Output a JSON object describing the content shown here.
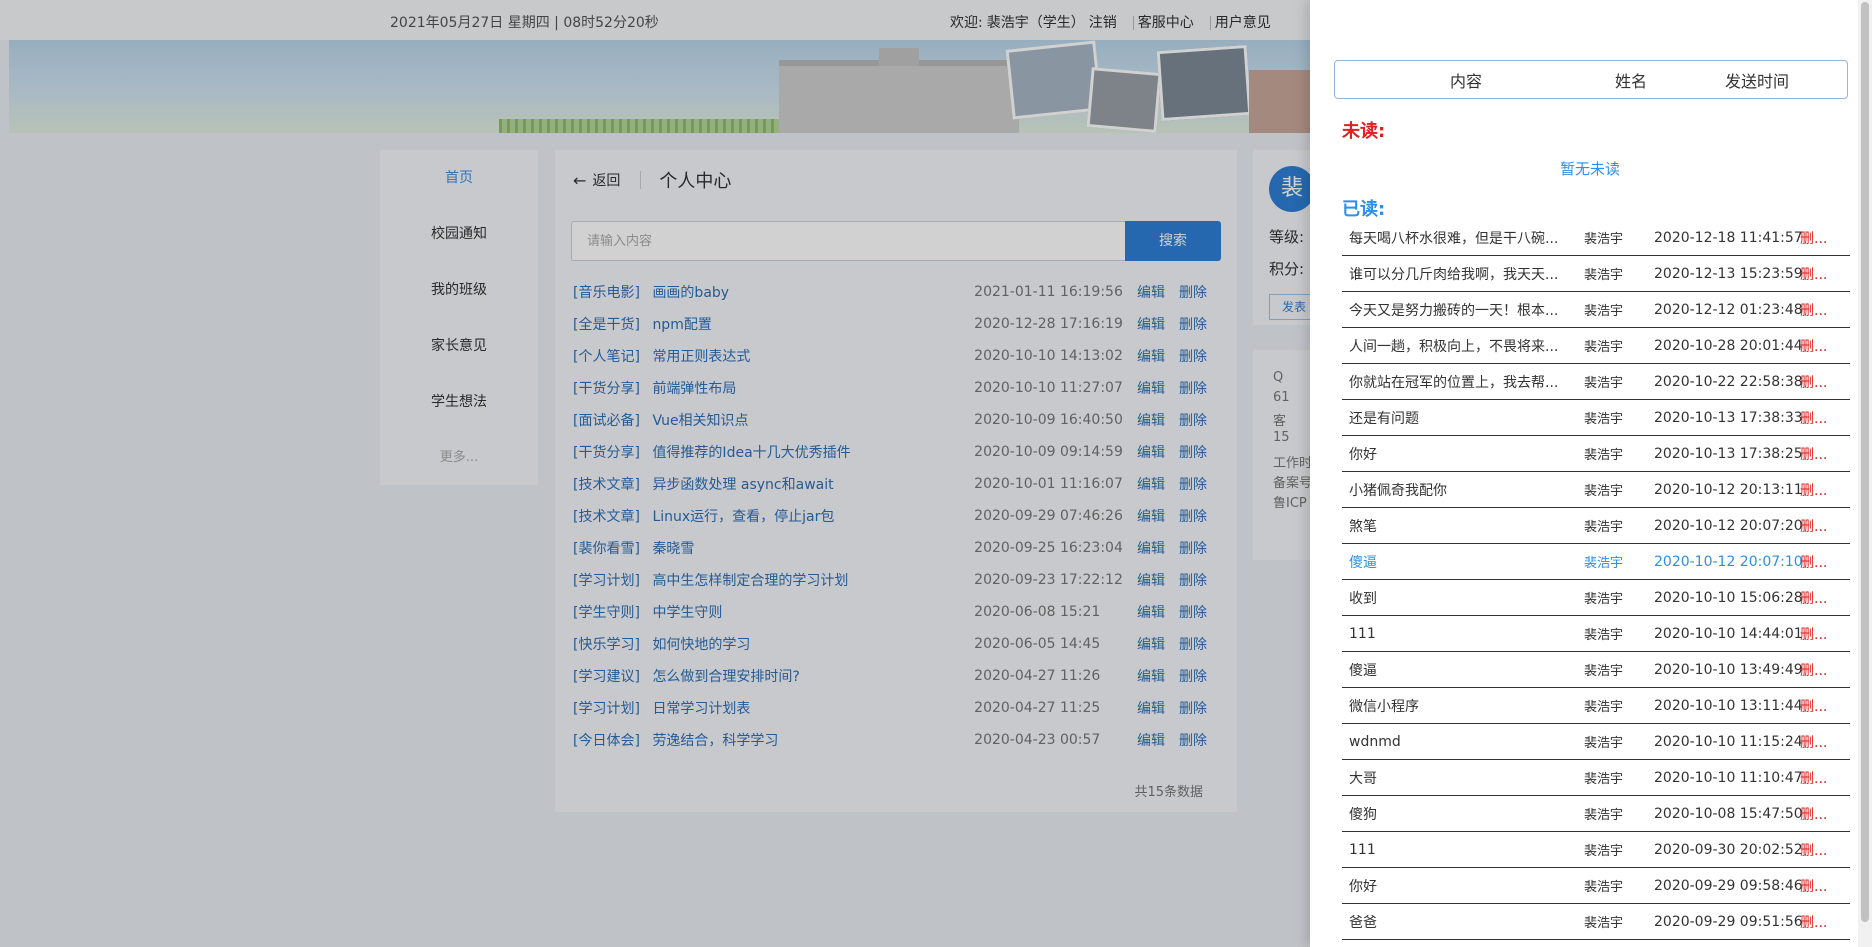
{
  "topbar": {
    "datetime": "2021年05月27日 星期四 | 08时52分20秒",
    "welcome_prefix": "欢迎:",
    "user": "裴浩宇（学生）",
    "logout": "注销",
    "service": "客服中心",
    "feedback": "用户意见"
  },
  "leftnav": {
    "items": [
      {
        "label": "首页"
      },
      {
        "label": "校园通知"
      },
      {
        "label": "我的班级"
      },
      {
        "label": "家长意见"
      },
      {
        "label": "学生想法"
      },
      {
        "label": "更多..."
      }
    ]
  },
  "main": {
    "back": "返回",
    "title": "个人中心",
    "search_placeholder": "请输入内容",
    "search_button": "搜索",
    "edit": "编辑",
    "delete": "删除",
    "rows": [
      {
        "cat": "[音乐电影]",
        "title": "画画的baby",
        "time": "2021-01-11 16:19:56"
      },
      {
        "cat": "[全是干货]",
        "title": "npm配置",
        "time": "2020-12-28 17:16:19"
      },
      {
        "cat": "[个人笔记]",
        "title": "常用正则表达式",
        "time": "2020-10-10 14:13:02"
      },
      {
        "cat": "[干货分享]",
        "title": "前端弹性布局",
        "time": "2020-10-10 11:27:07"
      },
      {
        "cat": "[面试必备]",
        "title": "Vue相关知识点",
        "time": "2020-10-09 16:40:50"
      },
      {
        "cat": "[干货分享]",
        "title": "值得推荐的Idea十几大优秀插件",
        "time": "2020-10-09 09:14:59"
      },
      {
        "cat": "[技术文章]",
        "title": "异步函数处理 async和await",
        "time": "2020-10-01 11:16:07"
      },
      {
        "cat": "[技术文章]",
        "title": "Linux运行，查看，停止jar包",
        "time": "2020-09-29 07:46:26"
      },
      {
        "cat": "[裴你看雪]",
        "title": "秦晓雪",
        "time": "2020-09-25 16:23:04"
      },
      {
        "cat": "[学习计划]",
        "title": "高中生怎样制定合理的学习计划",
        "time": "2020-09-23 17:22:12"
      },
      {
        "cat": "[学生守则]",
        "title": "中学生守则",
        "time": "2020-06-08 15:21"
      },
      {
        "cat": "[快乐学习]",
        "title": "如何快地的学习",
        "time": "2020-06-05 14:45"
      },
      {
        "cat": "[学习建议]",
        "title": "怎么做到合理安排时间?",
        "time": "2020-04-27 11:26"
      },
      {
        "cat": "[学习计划]",
        "title": "日常学习计划表",
        "time": "2020-04-27 11:25"
      },
      {
        "cat": "[今日体会]",
        "title": "劳逸结合，科学学习",
        "time": "2020-04-23 00:57"
      }
    ],
    "total": "共15条数据"
  },
  "rightcard": {
    "avatar": "裴",
    "level": "等级:",
    "points": "积分:",
    "btn": "发表",
    "info": [
      "Q",
      "61",
      "客",
      "15",
      "工作时",
      "备案号",
      "鲁ICP"
    ]
  },
  "drawer": {
    "col_content": "内容",
    "col_name": "姓名",
    "col_time": "发送时间",
    "unread_label": "未读:",
    "no_unread": "暂无未读",
    "read_label": "已读:",
    "messages": [
      {
        "text": "每天喝八杯水很难，但是干八碗...",
        "name": "裴浩宇",
        "time": "2020-12-18 11:41:57",
        "del": "删..."
      },
      {
        "text": "谁可以分几斤肉给我啊，我天天...",
        "name": "裴浩宇",
        "time": "2020-12-13 15:23:59",
        "del": "删..."
      },
      {
        "text": "今天又是努力搬砖的一天！根本...",
        "name": "裴浩宇",
        "time": "2020-12-12 01:23:48",
        "del": "删..."
      },
      {
        "text": "人间一趟，积极向上，不畏将来...",
        "name": "裴浩宇",
        "time": "2020-10-28 20:01:44",
        "del": "删..."
      },
      {
        "text": "你就站在冠军的位置上，我去帮...",
        "name": "裴浩宇",
        "time": "2020-10-22 22:58:38",
        "del": "删..."
      },
      {
        "text": "还是有问题",
        "name": "裴浩宇",
        "time": "2020-10-13 17:38:33",
        "del": "删..."
      },
      {
        "text": "你好",
        "name": "裴浩宇",
        "time": "2020-10-13 17:38:25",
        "del": "删..."
      },
      {
        "text": "小猪佩奇我配你",
        "name": "裴浩宇",
        "time": "2020-10-12 20:13:11",
        "del": "删..."
      },
      {
        "text": "煞笔",
        "name": "裴浩宇",
        "time": "2020-10-12 20:07:20",
        "del": "删..."
      },
      {
        "text": "傻逼",
        "name": "裴浩宇",
        "time": "2020-10-12 20:07:10",
        "del": "删..."
      },
      {
        "text": "收到",
        "name": "裴浩宇",
        "time": "2020-10-10 15:06:28",
        "del": "删..."
      },
      {
        "text": "111",
        "name": "裴浩宇",
        "time": "2020-10-10 14:44:01",
        "del": "删..."
      },
      {
        "text": "傻逼",
        "name": "裴浩宇",
        "time": "2020-10-10 13:49:49",
        "del": "删..."
      },
      {
        "text": "微信小程序",
        "name": "裴浩宇",
        "time": "2020-10-10 13:11:44",
        "del": "删..."
      },
      {
        "text": "wdnmd",
        "name": "裴浩宇",
        "time": "2020-10-10 11:15:24",
        "del": "删..."
      },
      {
        "text": "大哥",
        "name": "裴浩宇",
        "time": "2020-10-10 11:10:47",
        "del": "删..."
      },
      {
        "text": "傻狗",
        "name": "裴浩宇",
        "time": "2020-10-08 15:47:50",
        "del": "删..."
      },
      {
        "text": "111",
        "name": "裴浩宇",
        "time": "2020-09-30 20:02:52",
        "del": "删..."
      },
      {
        "text": "你好",
        "name": "裴浩宇",
        "time": "2020-09-29 09:58:46",
        "del": "删..."
      },
      {
        "text": "爸爸",
        "name": "裴浩宇",
        "time": "2020-09-29 09:51:56",
        "del": "删..."
      }
    ]
  },
  "colors": {
    "accent": "#2e8fe8",
    "danger": "#e02020",
    "link": "#2e6fb8"
  }
}
